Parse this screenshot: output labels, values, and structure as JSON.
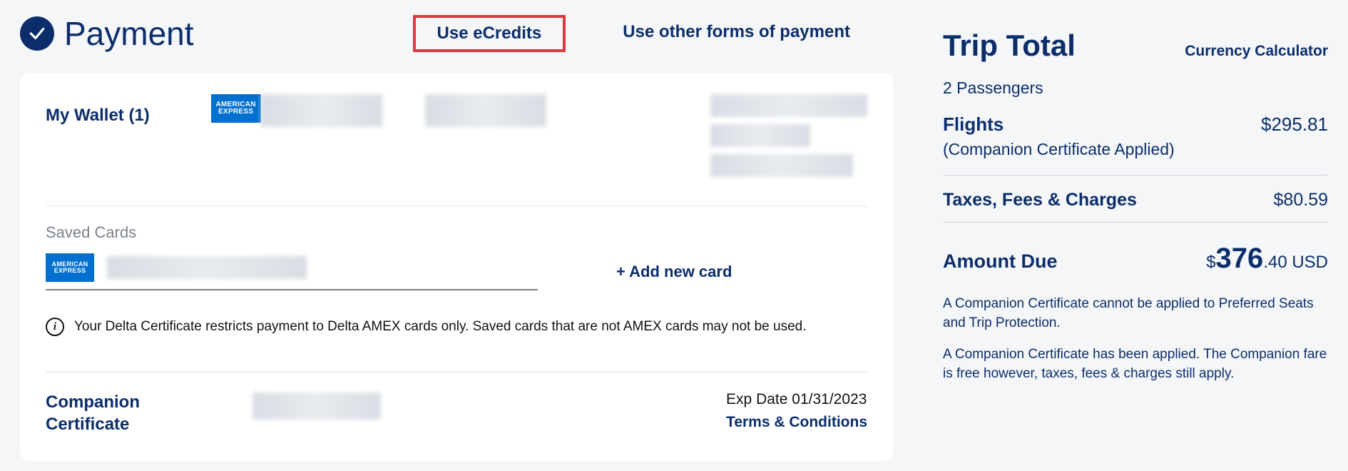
{
  "header": {
    "title": "Payment",
    "link_ecredits": "Use eCredits",
    "link_other": "Use other forms of payment"
  },
  "wallet": {
    "label": "My Wallet (1)",
    "card_brand": "AMERICAN EXPRESS"
  },
  "saved_cards": {
    "label": "Saved Cards",
    "card_brand": "AMERICAN EXPRESS",
    "add_card": "+ Add new card"
  },
  "info_notice": "Your Delta Certificate restricts payment to Delta AMEX cards only. Saved cards that are not AMEX cards may not be used.",
  "companion": {
    "label_line1": "Companion",
    "label_line2": "Certificate",
    "exp_prefix": "Exp Date ",
    "exp_date": "01/31/2023",
    "terms": "Terms & Conditions"
  },
  "trip": {
    "title": "Trip Total",
    "currency_link": "Currency Calculator",
    "passengers": "2 Passengers",
    "flights_label": "Flights",
    "flights_value": "$295.81",
    "flights_note": "(Companion Certificate Applied)",
    "taxes_label": "Taxes, Fees & Charges",
    "taxes_value": "$80.59",
    "amount_label": "Amount Due",
    "amount_prefix": "$",
    "amount_big": "376",
    "amount_suffix": ".40 USD",
    "note1": "A Companion Certificate cannot be applied to Preferred Seats and Trip Protection.",
    "note2": "A Companion Certificate has been applied. The Companion fare is free however, taxes, fees & charges still apply."
  }
}
